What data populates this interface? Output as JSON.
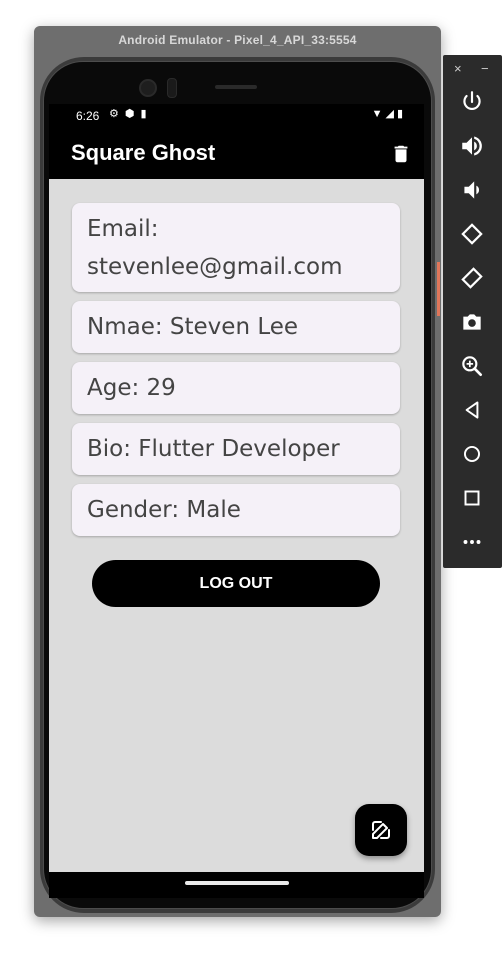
{
  "emulator": {
    "title": "Android Emulator - Pixel_4_API_33:5554",
    "toolbar": {
      "close": "×",
      "minimize": "−",
      "buttons": [
        "power-icon",
        "volume-up-icon",
        "volume-down-icon",
        "rotate-left-icon",
        "rotate-right-icon",
        "camera-icon",
        "zoom-icon",
        "back-icon",
        "home-icon",
        "overview-icon",
        "more-icon"
      ]
    }
  },
  "status_bar": {
    "time": "6:26"
  },
  "app_bar": {
    "title": "Square Ghost",
    "action_icon": "delete-icon"
  },
  "profile": {
    "email": "Email: stevenlee@gmail.com",
    "name": "Nmae: Steven Lee",
    "age": "Age: 29",
    "bio": "Bio: Flutter Developer",
    "gender": "Gender: Male"
  },
  "logout_label": "LOG OUT",
  "fab_icon": "edit-icon",
  "colors": {
    "app_bar": "#000000",
    "background": "#dcdcdc",
    "card": "#f5f1f8"
  }
}
